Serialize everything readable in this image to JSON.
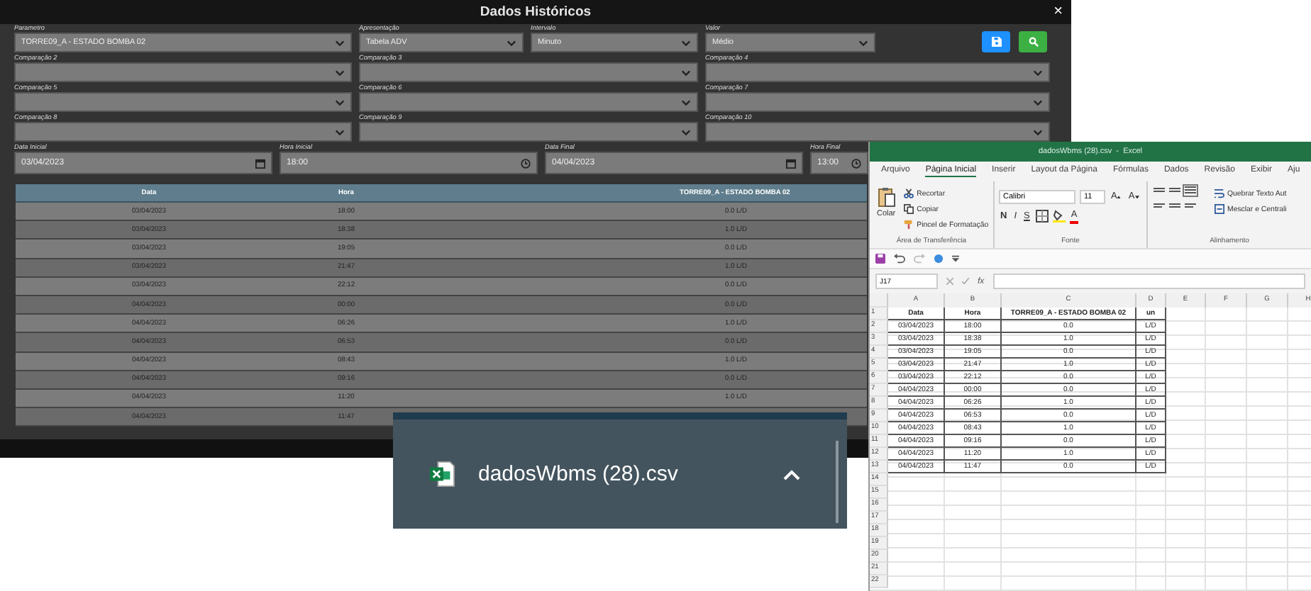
{
  "app_window": {
    "title": "Dados Históricos",
    "close": "×",
    "field_rows": [
      [
        {
          "kind": "select",
          "label": "Parametro",
          "value": "TORRE09_A - ESTADO BOMBA 02"
        },
        {
          "kind": "select",
          "label": "Apresentação",
          "value": "Tabela ADV"
        },
        {
          "kind": "select",
          "label": "Intervalo",
          "value": "Minuto"
        },
        {
          "kind": "select",
          "label": "Valor",
          "value": "Médio"
        }
      ],
      [
        {
          "kind": "select",
          "label": "Comparação 2"
        },
        {
          "kind": "select",
          "label": "Comparação 3"
        },
        {
          "kind": "select",
          "label": "Comparação 4"
        }
      ],
      [
        {
          "kind": "select",
          "label": "Comparação 5"
        },
        {
          "kind": "select",
          "label": "Comparação 6"
        },
        {
          "kind": "select",
          "label": "Comparação 7"
        }
      ],
      [
        {
          "kind": "select",
          "label": "Comparação 8"
        },
        {
          "kind": "select",
          "label": "Comparação 9"
        },
        {
          "kind": "select",
          "label": "Comparação 10"
        }
      ],
      [
        {
          "kind": "date",
          "label": "Data Inicial",
          "value": "03/04/2023"
        },
        {
          "kind": "time",
          "label": "Hora Inicial",
          "value": "18:00"
        },
        {
          "kind": "date",
          "label": "Data Final",
          "value": "04/04/2023"
        },
        {
          "kind": "time",
          "label": "Hora Final",
          "value": "13:00"
        }
      ]
    ],
    "actions": [
      {
        "kind": "save"
      },
      {
        "kind": "search"
      }
    ],
    "table": {
      "columns": [
        "Data",
        "Hora",
        "TORRE09_A - ESTADO BOMBA 02"
      ],
      "rows": [
        [
          "03/04/2023",
          "18:00",
          "0.0 L/D"
        ],
        [
          "03/04/2023",
          "18:38",
          "1.0 L/D"
        ],
        [
          "03/04/2023",
          "19:05",
          "0.0 L/D"
        ],
        [
          "03/04/2023",
          "21:47",
          "1.0 L/D"
        ],
        [
          "03/04/2023",
          "22:12",
          "0.0 L/D"
        ],
        [
          "04/04/2023",
          "00:00",
          "0.0 L/D"
        ],
        [
          "04/04/2023",
          "06:26",
          "1.0 L/D"
        ],
        [
          "04/04/2023",
          "06:53",
          "0.0 L/D"
        ],
        [
          "04/04/2023",
          "08:43",
          "1.0 L/D"
        ],
        [
          "04/04/2023",
          "09:16",
          "0.0 L/D"
        ],
        [
          "04/04/2023",
          "11:20",
          "1.0 L/D"
        ],
        [
          "04/04/2023",
          "11:47"
        ]
      ]
    }
  },
  "excel_window": {
    "title": "dadosWbms (28).csv  -  Excel",
    "tabs": [
      {
        "label": "Arquivo",
        "selected": false
      },
      {
        "label": "Página Inicial",
        "selected": true
      },
      {
        "label": "Inserir",
        "selected": false
      },
      {
        "label": "Layout da Página",
        "selected": false
      },
      {
        "label": "Fórmulas",
        "selected": false
      },
      {
        "label": "Dados",
        "selected": false
      },
      {
        "label": "Revisão",
        "selected": false
      },
      {
        "label": "Exibir",
        "selected": false
      },
      {
        "label": "Aju",
        "selected": false
      }
    ],
    "clipboard": {
      "paste": "Colar",
      "items": [
        {
          "kind": "cut",
          "label": "Recortar"
        },
        {
          "kind": "copy",
          "label": "Copiar"
        },
        {
          "kind": "brush",
          "label": "Pincel de Formatação"
        }
      ],
      "label": "Área de Transferência"
    },
    "font": {
      "name": "Calibri",
      "size": "11",
      "grow": "A",
      "shrink": "A",
      "styles": [
        "N",
        "I",
        "S"
      ],
      "color_button": "A",
      "label": "Fonte"
    },
    "alignment": {
      "items": [
        {
          "kind": "wrap",
          "label": "Quebrar Texto Aut"
        },
        {
          "kind": "merge",
          "label": "Mesclar e Centrali"
        }
      ],
      "label": "Alinhamento"
    },
    "name_box": "J17",
    "fx": "fx",
    "sheet": {
      "columns": [
        "A",
        "B",
        "C",
        "D",
        "E",
        "F",
        "G",
        "H"
      ],
      "row_numbers": [
        "1",
        "2",
        "3",
        "4",
        "5",
        "6",
        "7",
        "8",
        "9",
        "10",
        "11",
        "12",
        "13",
        "14",
        "15",
        "16",
        "17",
        "18",
        "19",
        "20",
        "21",
        "22"
      ],
      "rows": [
        [
          "Data",
          "Hora",
          "TORRE09_A - ESTADO BOMBA 02",
          "un"
        ],
        [
          "03/04/2023",
          "18:00",
          "0.0",
          "L/D"
        ],
        [
          "03/04/2023",
          "18:38",
          "1.0",
          "L/D"
        ],
        [
          "03/04/2023",
          "19:05",
          "0.0",
          "L/D"
        ],
        [
          "03/04/2023",
          "21:47",
          "1.0",
          "L/D"
        ],
        [
          "03/04/2023",
          "22:12",
          "0.0",
          "L/D"
        ],
        [
          "04/04/2023",
          "00:00",
          "0.0",
          "L/D"
        ],
        [
          "04/04/2023",
          "06:26",
          "1.0",
          "L/D"
        ],
        [
          "04/04/2023",
          "06:53",
          "0.0",
          "L/D"
        ],
        [
          "04/04/2023",
          "08:43",
          "1.0",
          "L/D"
        ],
        [
          "04/04/2023",
          "09:16",
          "0.0",
          "L/D"
        ],
        [
          "04/04/2023",
          "11:20",
          "1.0",
          "L/D"
        ],
        [
          "04/04/2023",
          "11:47",
          "0.0",
          "L/D"
        ]
      ]
    }
  },
  "download_bar": {
    "filename": "dadosWbms (28).csv"
  }
}
